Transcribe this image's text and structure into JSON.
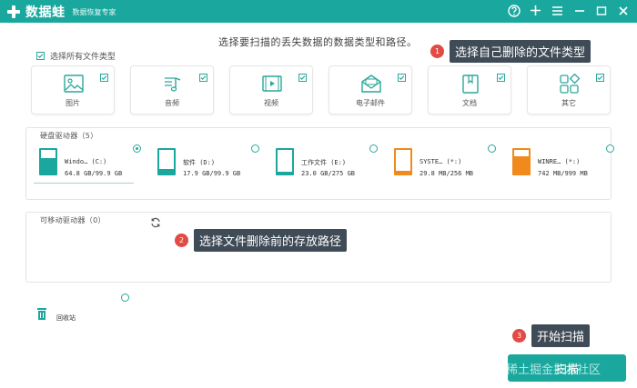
{
  "app": {
    "name": "数据蛙",
    "subtitle": "数据恢复专家"
  },
  "colors": {
    "brand": "#1aa89e",
    "annotation": "#e24a44",
    "callout_bg": "#3f4b56",
    "warn_drive": "#f08a1c"
  },
  "header": {
    "instruction": "选择要扫描的丢失数据的数据类型和路径。"
  },
  "select_all": {
    "label": "选择所有文件类型",
    "checked": true
  },
  "file_types": [
    {
      "label": "图片",
      "icon": "image-icon",
      "checked": true
    },
    {
      "label": "音频",
      "icon": "music-icon",
      "checked": true
    },
    {
      "label": "视频",
      "icon": "video-icon",
      "checked": true
    },
    {
      "label": "电子邮件",
      "icon": "email-icon",
      "checked": true
    },
    {
      "label": "文档",
      "icon": "document-icon",
      "checked": true
    },
    {
      "label": "其它",
      "icon": "other-icon",
      "checked": true
    }
  ],
  "hard_drives": {
    "title": "硬盘驱动器（5）",
    "drives": [
      {
        "name": "Windo… (C:)",
        "size": "64.8 GB/99.9 GB",
        "selected": true,
        "used_fraction": 0.65,
        "color": "#1aa89e"
      },
      {
        "name": "软件 (D:)",
        "size": "17.9 GB/99.9 GB",
        "selected": false,
        "used_fraction": 0.18,
        "color": "#1aa89e"
      },
      {
        "name": "工作文件 (E:)",
        "size": "23.0 GB/275 GB",
        "selected": false,
        "used_fraction": 0.08,
        "color": "#1aa89e"
      },
      {
        "name": "SYSTE… (*:)",
        "size": "29.8 MB/256 MB",
        "selected": false,
        "used_fraction": 0.12,
        "color": "#f08a1c"
      },
      {
        "name": "WINRE… (*:)",
        "size": "742 MB/999 MB",
        "selected": false,
        "used_fraction": 0.74,
        "color": "#f08a1c"
      }
    ]
  },
  "removable": {
    "title": "可移动驱动器（0）"
  },
  "recycle_bin": {
    "label": "回收站"
  },
  "annotations": [
    {
      "number": "1",
      "text": "选择自己删除的文件类型"
    },
    {
      "number": "2",
      "text": "选择文件删除前的存放路径"
    },
    {
      "number": "3",
      "text": "开始扫描"
    }
  ],
  "start_button": {
    "label": "扫描"
  },
  "watermark": "@稀土掘金技术社区"
}
